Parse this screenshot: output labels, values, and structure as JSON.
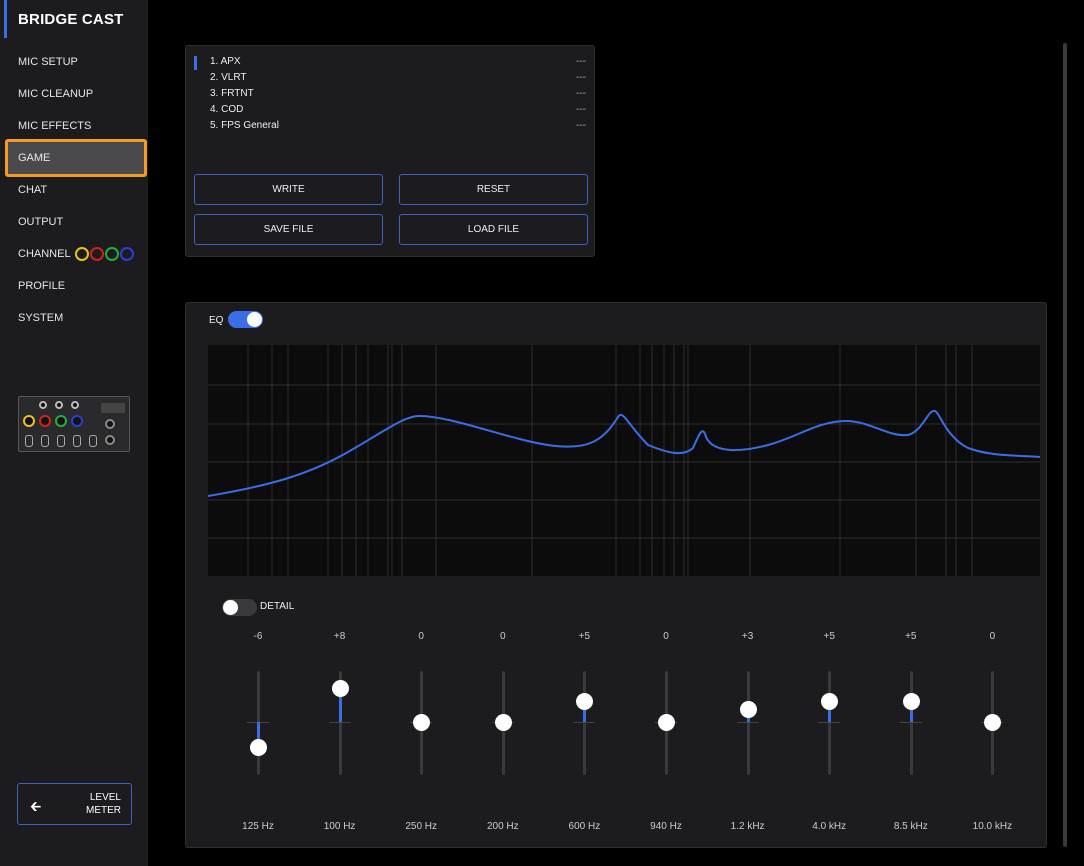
{
  "app": {
    "title": "BRIDGE CAST"
  },
  "nav": [
    {
      "label": "MIC SETUP"
    },
    {
      "label": "MIC CLEANUP"
    },
    {
      "label": "MIC EFFECTS"
    },
    {
      "label": "GAME",
      "active": true
    },
    {
      "label": "CHAT"
    },
    {
      "label": "OUTPUT"
    },
    {
      "label": "CHANNEL",
      "ring_colors": [
        "#e8c21a",
        "#d42020",
        "#20b040",
        "#2a3ed8"
      ]
    },
    {
      "label": "PROFILE"
    },
    {
      "label": "SYSTEM"
    }
  ],
  "level_meter": {
    "line1": "LEVEL",
    "line2": "METER",
    "icon": "arrow-left-icon"
  },
  "presets": [
    {
      "name": "1. APX",
      "value": "---"
    },
    {
      "name": "2. VLRT",
      "value": "---"
    },
    {
      "name": "3. FRTNT",
      "value": "---"
    },
    {
      "name": "4. COD",
      "value": "---"
    },
    {
      "name": "5. FPS General",
      "value": "---"
    }
  ],
  "buttons": {
    "write": "WRITE",
    "reset": "RESET",
    "save_file": "SAVE FILE",
    "load_file": "LOAD FILE"
  },
  "eq": {
    "label": "EQ",
    "enabled": true,
    "detail_label": "DETAIL",
    "detail_enabled": false,
    "accent": "#3a6ee8",
    "bands": [
      {
        "value": "-6",
        "freq": "125 Hz",
        "gain": -6
      },
      {
        "value": "+8",
        "freq": "100 Hz",
        "gain": 8
      },
      {
        "value": "0",
        "freq": "250 Hz",
        "gain": 0
      },
      {
        "value": "0",
        "freq": "200 Hz",
        "gain": 0
      },
      {
        "value": "+5",
        "freq": "600 Hz",
        "gain": 5
      },
      {
        "value": "0",
        "freq": "940 Hz",
        "gain": 0
      },
      {
        "value": "+3",
        "freq": "1.2 kHz",
        "gain": 3
      },
      {
        "value": "+5",
        "freq": "4.0 kHz",
        "gain": 5
      },
      {
        "value": "+5",
        "freq": "8.5 kHz",
        "gain": 5
      },
      {
        "value": "0",
        "freq": "10.0 kHz",
        "gain": 0
      }
    ]
  }
}
